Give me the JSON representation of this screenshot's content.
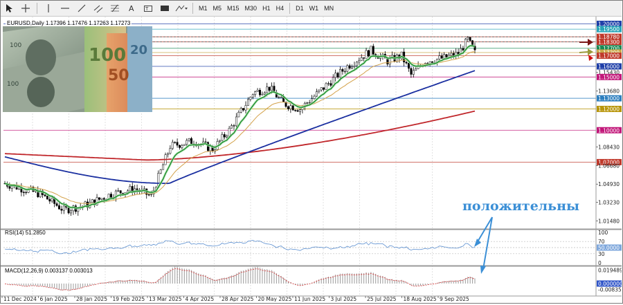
{
  "toolbar": {
    "timeframes": [
      "M1",
      "M5",
      "M15",
      "M30",
      "H1",
      "H4",
      "D1",
      "W1",
      "MN"
    ]
  },
  "chart": {
    "symbol_line": "EURUSD,Daily  1.17396 1.17476 1.17263 1.17273",
    "annotation": "положительны",
    "price_labels": [
      {
        "text": "1.20000",
        "color": "#1f3fa8"
      },
      {
        "text": "1.19500",
        "color": "#2aa6b8"
      },
      {
        "text": "1.18780",
        "color": "#c0392b"
      },
      {
        "text": "1.18300",
        "color": "#c0392b"
      },
      {
        "text": "1.17700",
        "color": "#1a8a55"
      },
      {
        "text": "1.17300",
        "color": "#c8a84a"
      },
      {
        "text": "1.17000",
        "color": "#c0392b"
      },
      {
        "text": "1.16000",
        "color": "#1f3fa8"
      },
      {
        "text": "1.15430",
        "color": ""
      },
      {
        "text": "1.15000",
        "color": "#c2187a"
      },
      {
        "text": "1.13680",
        "color": ""
      },
      {
        "text": "1.13000",
        "color": "#2d7fbf"
      },
      {
        "text": "1.12000",
        "color": "#b8960b"
      },
      {
        "text": "1.10000",
        "color": "#c2187a"
      },
      {
        "text": "1.08430",
        "color": ""
      },
      {
        "text": "1.07000",
        "color": "#c0392b"
      },
      {
        "text": "1.06680",
        "color": ""
      },
      {
        "text": "1.04930",
        "color": ""
      },
      {
        "text": "1.03230",
        "color": ""
      },
      {
        "text": "1.01480",
        "color": ""
      }
    ],
    "date_labels": [
      "11 Dec 2024",
      "6 Jan 2025",
      "28 Jan 2025",
      "19 Feb 2025",
      "13 Mar 2025",
      "4 Apr 2025",
      "28 Apr 2025",
      "20 May 2025",
      "11 Jun 2025",
      "3 Jul 2025",
      "25 Jul 2025",
      "18 Aug 2025",
      "9 Sep 2025"
    ]
  },
  "rsi": {
    "label": "RSI(14) 51.2850",
    "levels": [
      "100",
      "70",
      "50.0000",
      "30",
      "0"
    ]
  },
  "macd": {
    "label": "MACD(12,26,9) 0.003137 0.003013",
    "levels": [
      "0.019489",
      "0.000000",
      "-0.008351"
    ]
  },
  "colors": {
    "bg": "#ffffff",
    "candle": "#000000",
    "ema_fast": "#1a8a2a",
    "ema_mid": "#d4a24a",
    "ema_blue": "#1a2fa0",
    "ema_red": "#c0262a",
    "accent": "#3b8fd6"
  }
}
